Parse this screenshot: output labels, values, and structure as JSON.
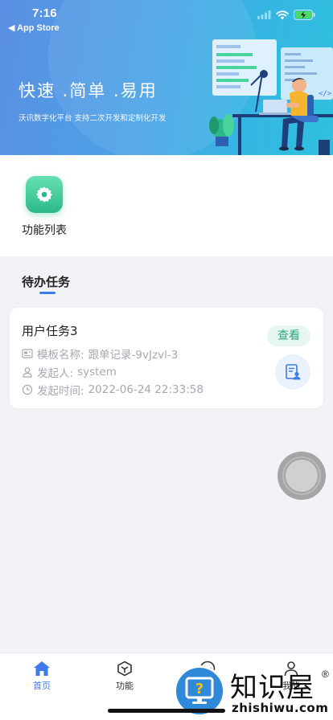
{
  "status_bar": {
    "time": "7:16",
    "back_label": "◀ App Store"
  },
  "hero": {
    "title": "快速 .简单 .易用",
    "subtitle": "沃讯数字化平台 支持二次开发和定制化开发"
  },
  "functions": [
    {
      "label": "功能列表",
      "icon": "gear-icon"
    }
  ],
  "todo": {
    "tab_label": "待办任务",
    "task": {
      "title": "用户任务3",
      "badge": "查看",
      "template_label": "模板名称:",
      "template_value": "跟单记录-9vJzvl-3",
      "initiator_label": "发起人:",
      "initiator_value": "system",
      "time_label": "发起时间:",
      "time_value": "2022-06-24 22:33:58"
    }
  },
  "tabbar": {
    "items": [
      {
        "label": "首页",
        "icon": "home-icon",
        "active": true
      },
      {
        "label": "功能",
        "icon": "cube-icon"
      },
      {
        "label": "",
        "icon": "chat-icon"
      },
      {
        "label": "我的",
        "icon": "user-icon"
      }
    ]
  },
  "watermark": {
    "cn": "知识屋",
    "en": "zhishiwu.com",
    "reg": "®"
  },
  "colors": {
    "accent": "#3d7bea",
    "green": "#2bb989",
    "badge_bg": "#e6f7f1"
  }
}
